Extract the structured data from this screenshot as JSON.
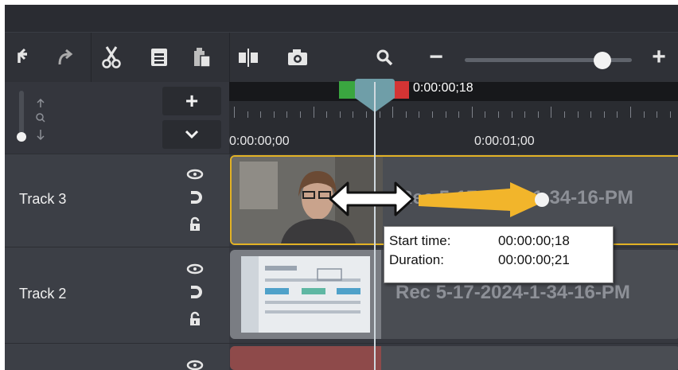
{
  "toolbar": {
    "icons": [
      "undo-icon",
      "redo-icon",
      "cut-icon",
      "copy-icon",
      "paste-icon",
      "split-icon",
      "snapshot-icon",
      "zoom-search-icon",
      "zoom-out-icon",
      "zoom-in-icon"
    ],
    "zoom_out_symbol": "−",
    "zoom_in_symbol": "+",
    "zoom_level": 0.8
  },
  "timeline": {
    "add_track_symbol": "+",
    "playhead_time": "0:00:00;18",
    "ruler_labels": [
      "0:00:00;00",
      "0:00:01;00"
    ]
  },
  "tracks": [
    {
      "name": "Track 3",
      "clip_name": "Rec 5-17-2024-1-34-16-PM"
    },
    {
      "name": "Track 2",
      "clip_name": "Rec 5-17-2024-1-34-16-PM"
    }
  ],
  "tooltip": {
    "start_label": "Start time:",
    "start_value": "00:00:00;18",
    "duration_label": "Duration:",
    "duration_value": "00:00:00;21"
  },
  "colors": {
    "accent_yellow": "#f2b52b",
    "playhead": "#6f9ea8",
    "in_marker": "#3aa640",
    "out_marker": "#d43434"
  }
}
